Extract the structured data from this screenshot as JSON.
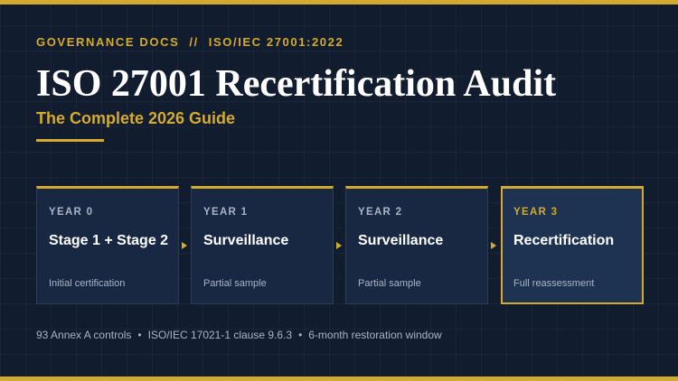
{
  "header": {
    "eyebrow_left": "GOVERNANCE DOCS",
    "eyebrow_sep": "//",
    "eyebrow_right": "ISO/IEC 27001:2022",
    "title": "ISO 27001 Recertification Audit",
    "subtitle": "The Complete 2026 Guide"
  },
  "timeline": [
    {
      "year": "YEAR 0",
      "name": "Stage 1 + Stage 2",
      "desc": "Initial certification",
      "highlighted": false
    },
    {
      "year": "YEAR 1",
      "name": "Surveillance",
      "desc": "Partial sample",
      "highlighted": false
    },
    {
      "year": "YEAR 2",
      "name": "Surveillance",
      "desc": "Partial sample",
      "highlighted": false
    },
    {
      "year": "YEAR 3",
      "name": "Recertification",
      "desc": "Full reassessment",
      "highlighted": true
    }
  ],
  "footer": {
    "items": [
      "93 Annex A controls",
      "ISO/IEC 17021-1 clause 9.6.3",
      "6-month restoration window"
    ],
    "separator": "•"
  },
  "colors": {
    "background": "#111c2e",
    "accent": "#d4aa2f",
    "card": "#182842",
    "card_active": "#1e3352",
    "muted_text": "#a9b4c6"
  }
}
